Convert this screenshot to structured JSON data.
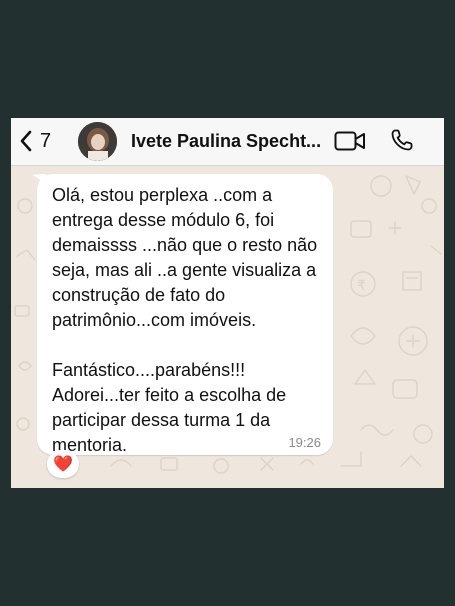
{
  "header": {
    "back_count": "7",
    "contact_name": "Ivete Paulina Specht...",
    "back_icon": "chevron-left-icon",
    "video_icon": "video-camera-icon",
    "call_icon": "phone-icon"
  },
  "message": {
    "text": "Olá, estou perplexa ..com a\nentrega desse módulo 6, foi\ndemaissss ...não que o resto não\nseja, mas ali ..a gente visualiza a\nconstrução de fato do\npatrimônio...com imóveis.\n\nFantástico....parabéns!!!\nAdorei...ter feito a escolha de\nparticipar dessa turma 1 da\nmentoria.",
    "time": "19:26",
    "reaction": "❤️"
  },
  "colors": {
    "outer_background": "#233030",
    "chat_wallpaper": "#efe7dd",
    "header_background": "#f7f7f7",
    "bubble": "#ffffff"
  }
}
